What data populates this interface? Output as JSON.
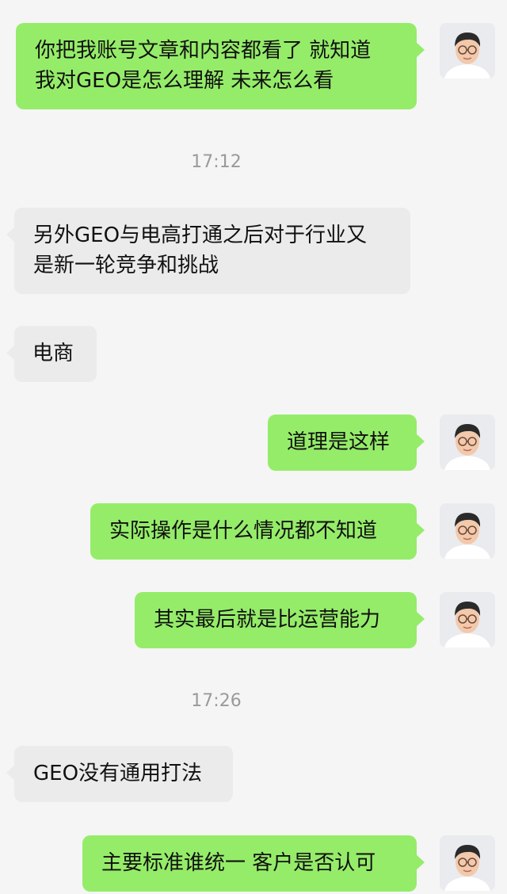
{
  "chat": {
    "messages": [
      {
        "side": "me",
        "text": "你把我账号文章和内容都看了 就知道\n我对GEO是怎么理解 未来怎么看"
      },
      {
        "timestamp": "17:12"
      },
      {
        "side": "other",
        "text": "另外GEO与电高打通之后对于行业又\n是新一轮竞争和挑战"
      },
      {
        "side": "other",
        "text": "电商"
      },
      {
        "side": "me",
        "text": "道理是这样"
      },
      {
        "side": "me",
        "text": "实际操作是什么情况都不知道"
      },
      {
        "side": "me",
        "text": "其实最后就是比运营能力"
      },
      {
        "timestamp": "17:26"
      },
      {
        "side": "other",
        "text": "GEO没有通用打法"
      },
      {
        "side": "me",
        "text": "主要标准谁统一 客户是否认可"
      }
    ]
  },
  "colors": {
    "background": "#f5f5f5",
    "self_bubble": "#95ec69",
    "other_bubble": "#ebebeb",
    "timestamp_text": "#9a9a9a"
  },
  "icons": {
    "self_avatar": "user-avatar-icon"
  }
}
